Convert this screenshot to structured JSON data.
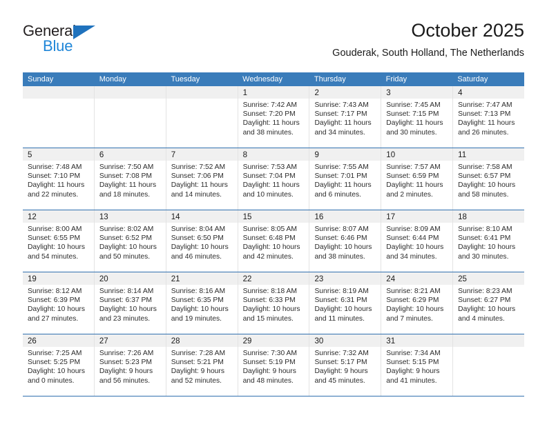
{
  "brand": {
    "name_top": "General",
    "name_bottom": "Blue",
    "triangle_color": "#1f72bd",
    "blue_color": "#1f86d8"
  },
  "header": {
    "title": "October 2025",
    "location": "Gouderak, South Holland, The Netherlands"
  },
  "theme": {
    "header_bg": "#3a7cba",
    "header_text": "#ffffff",
    "row_divider": "#2f6fae",
    "daynum_band": "#f0f0f0"
  },
  "weekdays": [
    "Sunday",
    "Monday",
    "Tuesday",
    "Wednesday",
    "Thursday",
    "Friday",
    "Saturday"
  ],
  "weeks": [
    [
      {
        "day": "",
        "sunrise": "",
        "sunset": "",
        "daylight1": "",
        "daylight2": ""
      },
      {
        "day": "",
        "sunrise": "",
        "sunset": "",
        "daylight1": "",
        "daylight2": ""
      },
      {
        "day": "",
        "sunrise": "",
        "sunset": "",
        "daylight1": "",
        "daylight2": ""
      },
      {
        "day": "1",
        "sunrise": "Sunrise: 7:42 AM",
        "sunset": "Sunset: 7:20 PM",
        "daylight1": "Daylight: 11 hours",
        "daylight2": "and 38 minutes."
      },
      {
        "day": "2",
        "sunrise": "Sunrise: 7:43 AM",
        "sunset": "Sunset: 7:17 PM",
        "daylight1": "Daylight: 11 hours",
        "daylight2": "and 34 minutes."
      },
      {
        "day": "3",
        "sunrise": "Sunrise: 7:45 AM",
        "sunset": "Sunset: 7:15 PM",
        "daylight1": "Daylight: 11 hours",
        "daylight2": "and 30 minutes."
      },
      {
        "day": "4",
        "sunrise": "Sunrise: 7:47 AM",
        "sunset": "Sunset: 7:13 PM",
        "daylight1": "Daylight: 11 hours",
        "daylight2": "and 26 minutes."
      }
    ],
    [
      {
        "day": "5",
        "sunrise": "Sunrise: 7:48 AM",
        "sunset": "Sunset: 7:10 PM",
        "daylight1": "Daylight: 11 hours",
        "daylight2": "and 22 minutes."
      },
      {
        "day": "6",
        "sunrise": "Sunrise: 7:50 AM",
        "sunset": "Sunset: 7:08 PM",
        "daylight1": "Daylight: 11 hours",
        "daylight2": "and 18 minutes."
      },
      {
        "day": "7",
        "sunrise": "Sunrise: 7:52 AM",
        "sunset": "Sunset: 7:06 PM",
        "daylight1": "Daylight: 11 hours",
        "daylight2": "and 14 minutes."
      },
      {
        "day": "8",
        "sunrise": "Sunrise: 7:53 AM",
        "sunset": "Sunset: 7:04 PM",
        "daylight1": "Daylight: 11 hours",
        "daylight2": "and 10 minutes."
      },
      {
        "day": "9",
        "sunrise": "Sunrise: 7:55 AM",
        "sunset": "Sunset: 7:01 PM",
        "daylight1": "Daylight: 11 hours",
        "daylight2": "and 6 minutes."
      },
      {
        "day": "10",
        "sunrise": "Sunrise: 7:57 AM",
        "sunset": "Sunset: 6:59 PM",
        "daylight1": "Daylight: 11 hours",
        "daylight2": "and 2 minutes."
      },
      {
        "day": "11",
        "sunrise": "Sunrise: 7:58 AM",
        "sunset": "Sunset: 6:57 PM",
        "daylight1": "Daylight: 10 hours",
        "daylight2": "and 58 minutes."
      }
    ],
    [
      {
        "day": "12",
        "sunrise": "Sunrise: 8:00 AM",
        "sunset": "Sunset: 6:55 PM",
        "daylight1": "Daylight: 10 hours",
        "daylight2": "and 54 minutes."
      },
      {
        "day": "13",
        "sunrise": "Sunrise: 8:02 AM",
        "sunset": "Sunset: 6:52 PM",
        "daylight1": "Daylight: 10 hours",
        "daylight2": "and 50 minutes."
      },
      {
        "day": "14",
        "sunrise": "Sunrise: 8:04 AM",
        "sunset": "Sunset: 6:50 PM",
        "daylight1": "Daylight: 10 hours",
        "daylight2": "and 46 minutes."
      },
      {
        "day": "15",
        "sunrise": "Sunrise: 8:05 AM",
        "sunset": "Sunset: 6:48 PM",
        "daylight1": "Daylight: 10 hours",
        "daylight2": "and 42 minutes."
      },
      {
        "day": "16",
        "sunrise": "Sunrise: 8:07 AM",
        "sunset": "Sunset: 6:46 PM",
        "daylight1": "Daylight: 10 hours",
        "daylight2": "and 38 minutes."
      },
      {
        "day": "17",
        "sunrise": "Sunrise: 8:09 AM",
        "sunset": "Sunset: 6:44 PM",
        "daylight1": "Daylight: 10 hours",
        "daylight2": "and 34 minutes."
      },
      {
        "day": "18",
        "sunrise": "Sunrise: 8:10 AM",
        "sunset": "Sunset: 6:41 PM",
        "daylight1": "Daylight: 10 hours",
        "daylight2": "and 30 minutes."
      }
    ],
    [
      {
        "day": "19",
        "sunrise": "Sunrise: 8:12 AM",
        "sunset": "Sunset: 6:39 PM",
        "daylight1": "Daylight: 10 hours",
        "daylight2": "and 27 minutes."
      },
      {
        "day": "20",
        "sunrise": "Sunrise: 8:14 AM",
        "sunset": "Sunset: 6:37 PM",
        "daylight1": "Daylight: 10 hours",
        "daylight2": "and 23 minutes."
      },
      {
        "day": "21",
        "sunrise": "Sunrise: 8:16 AM",
        "sunset": "Sunset: 6:35 PM",
        "daylight1": "Daylight: 10 hours",
        "daylight2": "and 19 minutes."
      },
      {
        "day": "22",
        "sunrise": "Sunrise: 8:18 AM",
        "sunset": "Sunset: 6:33 PM",
        "daylight1": "Daylight: 10 hours",
        "daylight2": "and 15 minutes."
      },
      {
        "day": "23",
        "sunrise": "Sunrise: 8:19 AM",
        "sunset": "Sunset: 6:31 PM",
        "daylight1": "Daylight: 10 hours",
        "daylight2": "and 11 minutes."
      },
      {
        "day": "24",
        "sunrise": "Sunrise: 8:21 AM",
        "sunset": "Sunset: 6:29 PM",
        "daylight1": "Daylight: 10 hours",
        "daylight2": "and 7 minutes."
      },
      {
        "day": "25",
        "sunrise": "Sunrise: 8:23 AM",
        "sunset": "Sunset: 6:27 PM",
        "daylight1": "Daylight: 10 hours",
        "daylight2": "and 4 minutes."
      }
    ],
    [
      {
        "day": "26",
        "sunrise": "Sunrise: 7:25 AM",
        "sunset": "Sunset: 5:25 PM",
        "daylight1": "Daylight: 10 hours",
        "daylight2": "and 0 minutes."
      },
      {
        "day": "27",
        "sunrise": "Sunrise: 7:26 AM",
        "sunset": "Sunset: 5:23 PM",
        "daylight1": "Daylight: 9 hours",
        "daylight2": "and 56 minutes."
      },
      {
        "day": "28",
        "sunrise": "Sunrise: 7:28 AM",
        "sunset": "Sunset: 5:21 PM",
        "daylight1": "Daylight: 9 hours",
        "daylight2": "and 52 minutes."
      },
      {
        "day": "29",
        "sunrise": "Sunrise: 7:30 AM",
        "sunset": "Sunset: 5:19 PM",
        "daylight1": "Daylight: 9 hours",
        "daylight2": "and 48 minutes."
      },
      {
        "day": "30",
        "sunrise": "Sunrise: 7:32 AM",
        "sunset": "Sunset: 5:17 PM",
        "daylight1": "Daylight: 9 hours",
        "daylight2": "and 45 minutes."
      },
      {
        "day": "31",
        "sunrise": "Sunrise: 7:34 AM",
        "sunset": "Sunset: 5:15 PM",
        "daylight1": "Daylight: 9 hours",
        "daylight2": "and 41 minutes."
      },
      {
        "day": "",
        "sunrise": "",
        "sunset": "",
        "daylight1": "",
        "daylight2": ""
      }
    ]
  ]
}
